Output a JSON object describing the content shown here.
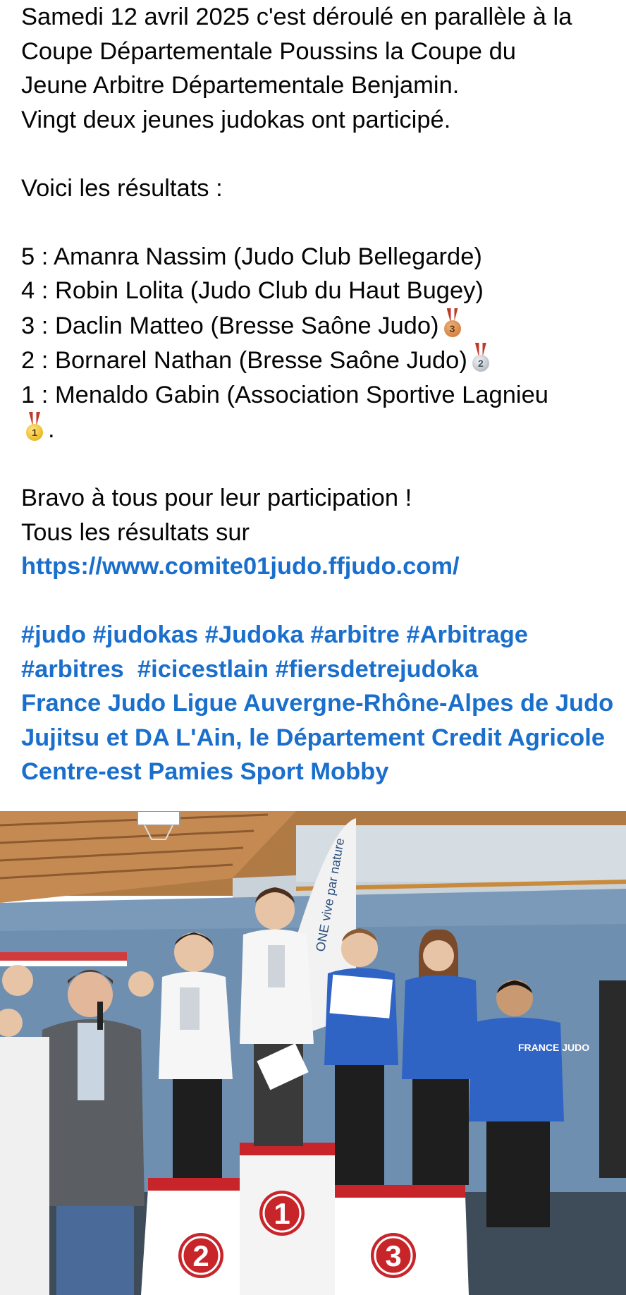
{
  "post": {
    "intro_lines": [
      "Samedi 12 avril 2025 c'est déroulé en parallèle à la",
      "Coupe Départementale Poussins la Coupe du",
      "Jeune Arbitre Départementale Benjamin.",
      "Vingt deux jeunes judokas ont participé."
    ],
    "results_heading": "Voici les résultats :",
    "results": [
      "5 : Amanra Nassim (Judo Club Bellegarde)",
      "4 : Robin Lolita (Judo Club du Haut Bugey)",
      "3 : Daclin Matteo (Bresse Saône Judo)",
      "2 : Bornarel Nathan (Bresse Saône Judo)",
      "1 : Menaldo Gabin (Association Sportive Lagnieu"
    ],
    "result_medals": [
      "",
      "",
      "bronze-medal-icon",
      "silver-medal-icon",
      ""
    ],
    "medal_numbers": {
      "bronze": "3",
      "silver": "2",
      "gold": "1"
    },
    "gold_line_suffix": ".",
    "bravo": "Bravo à tous pour leur participation !",
    "all_results": "Tous les résultats sur",
    "link": "https://www.comite01judo.ffjudo.com/",
    "hashtags_line1": "#judo #judokas #Judoka #arbitre #Arbitrage",
    "hashtags_line2": "#arbitres  #icicestlain #fiersdetrejudoka",
    "mentions": [
      "France Judo Ligue Auvergne-Rhône-Alpes de Judo",
      "Jujitsu et DA L'Ain, le Département Credit Agricole",
      "Centre-est Pamies Sport Mobby"
    ]
  },
  "photo": {
    "banner_text": "ONE   vive par nature",
    "shirt_text": "FRANCE JUDO",
    "podium_labels": [
      "2",
      "1",
      "3"
    ]
  },
  "colors": {
    "link": "#1a6fcc",
    "text": "#050505",
    "podium_red": "#c8252b"
  }
}
